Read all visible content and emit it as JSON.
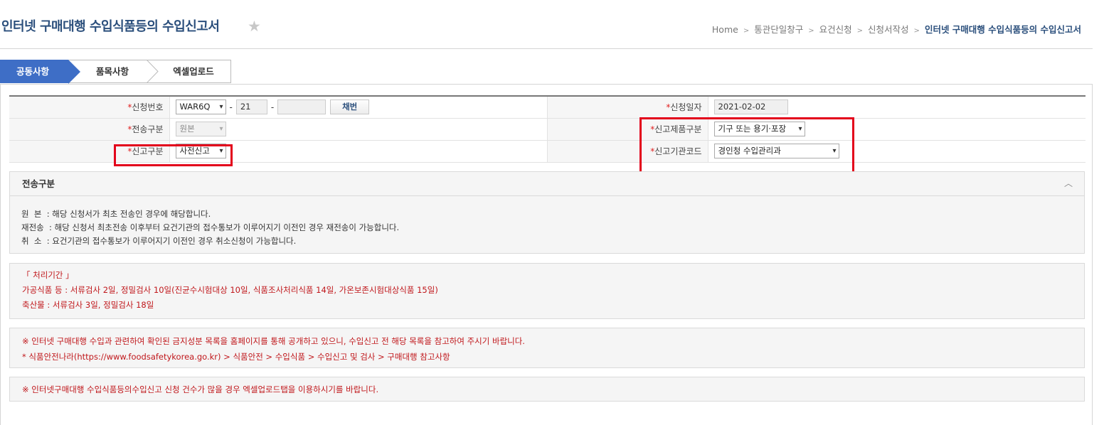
{
  "header": {
    "title": "인터넷 구매대행 수입식품등의 수입신고서",
    "favorite_icon": "star-icon",
    "breadcrumb": [
      "Home",
      "통관단일창구",
      "요건신청",
      "신청서작성",
      "인터넷 구매대행 수입식품등의 수입신고서"
    ]
  },
  "tabs": [
    "공동사항",
    "품목사항",
    "엑셀업로드"
  ],
  "form": {
    "required_mark": "*",
    "app_no_label": "신청번호",
    "app_no_prefix": "WAR6Q",
    "app_no_year": "21",
    "app_no_serial": "",
    "dash": "-",
    "issue_button": "채번",
    "app_date_label": "신청일자",
    "app_date": "2021-02-02",
    "send_type_label": "전송구분",
    "send_type_value": "원본",
    "product_type_label": "신고제품구분",
    "product_type_value": "기구 또는 용기·포장",
    "report_type_label": "신고구분",
    "report_type_value": "사전신고",
    "agency_code_label": "신고기관코드",
    "agency_code_value": "경인청 수입관리과"
  },
  "send_info": {
    "title": "전송구분",
    "lines": [
      "원  본  : 해당 신청서가 최초 전송인 경우에 해당합니다.",
      "재전송  : 해당 신청서 최초전송 이후부터 요건기관의 접수통보가 이루어지기 이전인 경우 재전송이 가능합니다.",
      "취  소  : 요건기관의 접수통보가 이루어지기 이전인 경우 취소신청이 가능합니다."
    ]
  },
  "processing": {
    "lines": [
      "「 처리기간 」",
      "가공식품 등 : 서류검사 2일, 정밀검사 10일(진균수시험대상 10일, 식품조사처리식품 14일, 가온보존시험대상식품 15일)",
      "축산물 : 서류검사 3일, 정밀검사 18일"
    ]
  },
  "notice1": {
    "lines": [
      "※ 인터넷 구매대행 수입과 관련하여 확인된 금지성분 목록을 홈페이지를 통해 공개하고 있으니, 수입신고 전 해당 목록을 참고하여 주시기 바랍니다.",
      "* 식품안전나라(https://www.foodsafetykorea.go.kr) > 식품안전 > 수입식품 > 수입신고 및 검사 > 구매대행 참고사항"
    ]
  },
  "notice2": {
    "text": "※ 인터넷구매대행 수입식품등의수입신고 신청 건수가 많을 경우 엑셀업로드탭을 이용하시기를 바랍니다."
  },
  "colors": {
    "accent": "#3e6ec6",
    "title": "#2b4f7c",
    "highlight": "#e3001b",
    "notice": "#c0171b"
  }
}
